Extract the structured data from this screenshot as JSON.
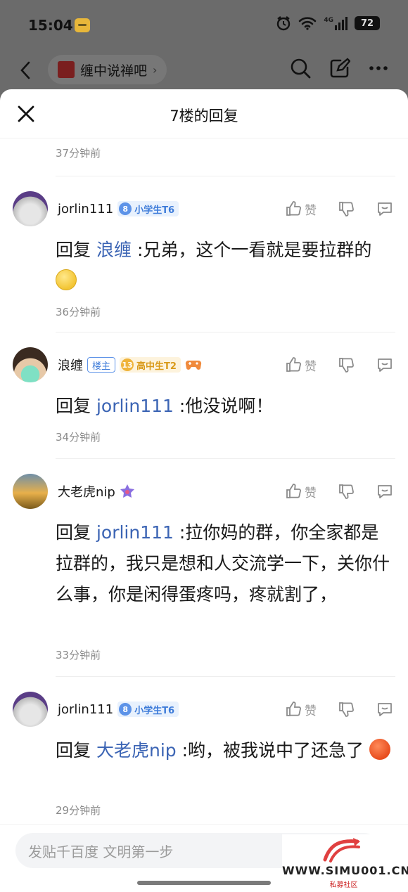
{
  "status_bar": {
    "time": "15:04",
    "network": "4G",
    "battery": "72"
  },
  "top_nav": {
    "forum_name": "缠中说禅吧",
    "chevron": "›"
  },
  "sheet": {
    "title": "7楼的回复",
    "previous_timestamp": "37分钟前"
  },
  "replies": [
    {
      "username": "jorlin111",
      "level_num": "8",
      "level_title": "小学生T6",
      "like_label": "赞",
      "reply_prefix": "回复",
      "mention": "浪缠",
      "text": ":兄弟，这个一看就是要拉群的",
      "emoji": "smile-emoji",
      "timestamp": "36分钟前"
    },
    {
      "username": "浪缠",
      "owner_badge": "楼主",
      "level_num": "13",
      "level_title": "高中生T2",
      "like_label": "赞",
      "reply_prefix": "回复",
      "mention": "jorlin111",
      "text": ":他没说啊！",
      "timestamp": "34分钟前"
    },
    {
      "username": "大老虎nip",
      "like_label": "赞",
      "reply_prefix": "回复",
      "mention": "jorlin111",
      "text": ":拉你妈的群，你全家都是拉群的，我只是想和人交流学一下，关你什么事，你是闲得蛋疼吗，疼就割了，",
      "timestamp": "33分钟前"
    },
    {
      "username": "jorlin111",
      "level_num": "8",
      "level_title": "小学生T6",
      "like_label": "赞",
      "reply_prefix": "回复",
      "mention": "大老虎nip",
      "text": ":哟，被我说中了还急了",
      "emoji": "angry-emoji",
      "timestamp": "29分钟前"
    }
  ],
  "compose": {
    "placeholder": "发贴千百度 文明第一步"
  },
  "watermark": {
    "site": "WWW.SIMU001.CN",
    "sub": "私募社区"
  },
  "colors": {
    "mention": "#3b64b4",
    "level_badge": "#3d7bd9",
    "gold_badge": "#d99a1a",
    "overlay": "#6b6b6b"
  }
}
